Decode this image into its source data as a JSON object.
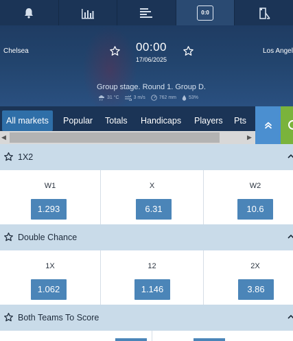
{
  "topbar": {
    "icons": [
      "bell-icon",
      "stats-chart-icon",
      "list-lines-icon",
      "scoreboard-icon",
      "field-icon"
    ],
    "scoreboard_label": "0:0"
  },
  "match": {
    "team_home": "Chelsea",
    "team_away": "Los Angeles",
    "time": "00:00",
    "date": "17/06/2025",
    "stage": "Group stage. Round 1. Group D.",
    "weather": {
      "temperature": "31 °C",
      "wind": "3 m/s",
      "pressure": "762 mm",
      "humidity": "53%"
    }
  },
  "tabs": {
    "items": [
      "All markets",
      "Popular",
      "Totals",
      "Handicaps",
      "Players",
      "Pts"
    ],
    "active": "All markets"
  },
  "markets": [
    {
      "title": "1X2",
      "outcomes": [
        {
          "label": "W1",
          "odd": "1.293"
        },
        {
          "label": "X",
          "odd": "6.31"
        },
        {
          "label": "W2",
          "odd": "10.6"
        }
      ]
    },
    {
      "title": "Double Chance",
      "outcomes": [
        {
          "label": "1X",
          "odd": "1.062"
        },
        {
          "label": "12",
          "odd": "1.146"
        },
        {
          "label": "2X",
          "odd": "3.86"
        }
      ]
    },
    {
      "title": "Both Teams To Score",
      "outcomes": []
    }
  ],
  "colors": {
    "topbar": "#1b3456",
    "tab_active": "#2f6fa8",
    "collapse_button": "#4b8fd0",
    "market_header": "#c9dbe9",
    "odd_button": "#4b85b8",
    "green_button": "#7ab33c"
  }
}
